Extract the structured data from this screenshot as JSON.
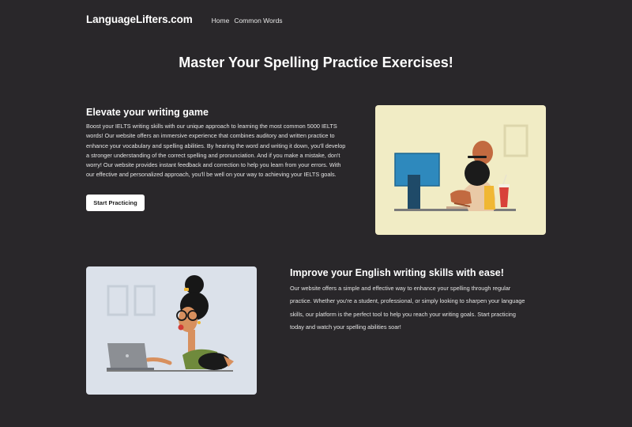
{
  "header": {
    "logo": "LanguageLifters.com",
    "nav": [
      "Home",
      "Common Words"
    ]
  },
  "page_title": "Master Your Spelling Practice Exercises!",
  "section1": {
    "heading": "Elevate your writing game",
    "body": "Boost your IELTS writing skills with our unique approach to learning the most common 5000 IELTS words! Our website offers an immersive experience that combines auditory and written practice to enhance your vocabulary and spelling abilities. By hearing the word and writing it down, you'll develop a stronger understanding of the correct spelling and pronunciation. And if you make a mistake, don't worry! Our website provides instant feedback and correction to help you learn from your errors. With our effective and personalized approach, you'll be well on your way to achieving your IELTS goals.",
    "button": "Start Practicing"
  },
  "section2": {
    "heading": "Improve your English writing skills with ease!",
    "body": "Our website offers a simple and effective way to enhance your spelling through regular practice. Whether you're a student, professional, or simply looking to sharpen your language skills, our platform is the perfect tool to help you reach your writing goals. Start practicing today and watch your spelling abilities soar!"
  },
  "colors": {
    "background": "#29272a",
    "illustration1_bg": "#f1ecc5",
    "illustration2_bg": "#dbe1ea",
    "button_bg": "#ffffff"
  }
}
